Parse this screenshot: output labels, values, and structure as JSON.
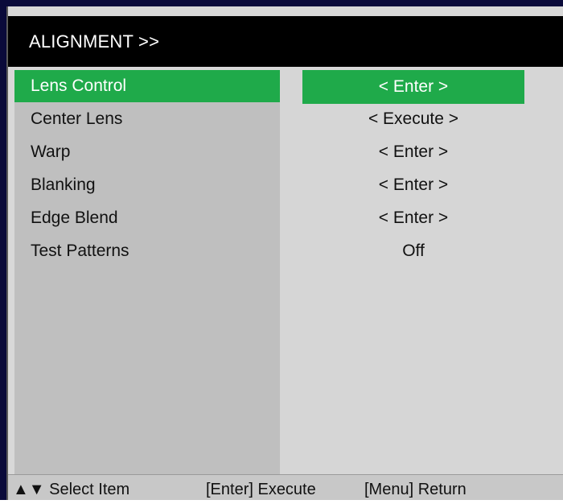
{
  "header": {
    "title": "ALIGNMENT >>"
  },
  "menu": {
    "items": [
      {
        "label": "Lens Control",
        "value": "< Enter >",
        "selected": true
      },
      {
        "label": "Center Lens",
        "value": "< Execute >",
        "selected": false
      },
      {
        "label": "Warp",
        "value": "< Enter >",
        "selected": false
      },
      {
        "label": "Blanking",
        "value": "< Enter >",
        "selected": false
      },
      {
        "label": "Edge Blend",
        "value": "< Enter >",
        "selected": false
      },
      {
        "label": "Test Patterns",
        "value": "Off",
        "selected": false
      }
    ]
  },
  "footer": {
    "select_hint": "▲▼ Select Item",
    "enter_hint": "[Enter] Execute",
    "menu_hint": "[Menu] Return"
  },
  "colors": {
    "selected": "#1faa4a",
    "header_bg": "#000000",
    "label_column_bg": "#bfbfbf",
    "value_column_bg": "#d6d6d6"
  }
}
